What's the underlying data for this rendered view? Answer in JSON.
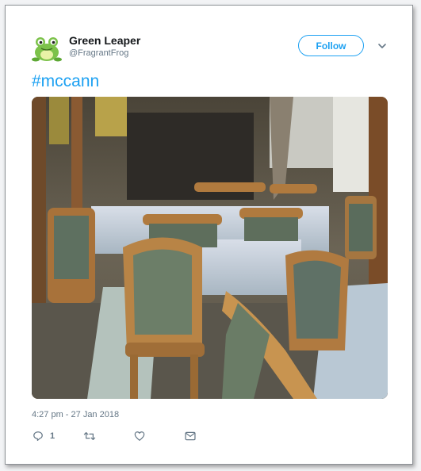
{
  "user": {
    "name": "Green Leaper",
    "handle": "@FragrantFrog"
  },
  "follow_label": "Follow",
  "tweet": {
    "text": "#mccann",
    "timestamp": "4:27 pm - 27 Jan 2018",
    "reply_count": "1"
  },
  "icons": [
    "frog-avatar",
    "chevron-down-icon",
    "reply-icon",
    "retweet-icon",
    "like-icon",
    "message-icon"
  ],
  "colors": {
    "accent": "#1da1f2",
    "muted": "#657786",
    "text": "#14171a"
  }
}
